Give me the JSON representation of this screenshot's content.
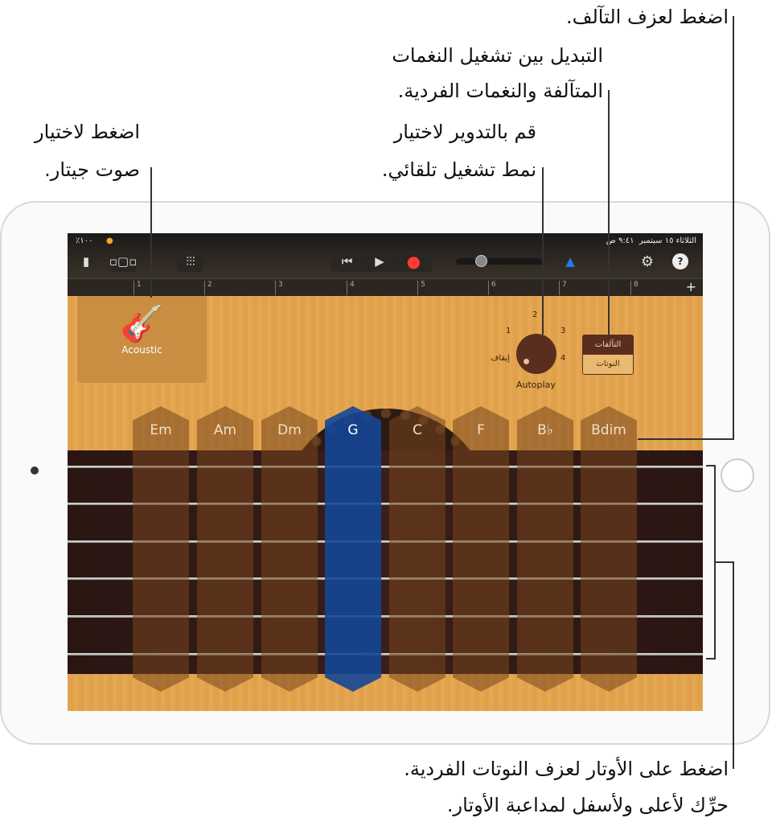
{
  "annotations": {
    "chords": "اضغط لعزف التآلف.",
    "toggle_1": "التبديل بين تشغيل النغمات",
    "toggle_2": "المتآلفة والنغمات الفردية.",
    "autoplay_1": "قم بالتدوير لاختيار",
    "autoplay_2": "نمط تشغيل تلقائي.",
    "sound_1": "اضغط لاختيار",
    "sound_2": "صوت جيتار.",
    "strings_1": "اضغط على الأوتار لعزف النوتات الفردية.",
    "strings_2": "حرِّك لأعلى ولأسفل لمداعبة الأوتار."
  },
  "status": {
    "time": "٩:٤١ ص",
    "date": "الثلاثاء ١٥ سبتمبر",
    "battery": "٪١٠٠"
  },
  "toolbar": {
    "icons": [
      "document-icon",
      "view-toggle-icon",
      "mixer-icon",
      "rewind-icon",
      "play-icon",
      "record-icon",
      "metronome-icon",
      "settings-icon",
      "help-icon"
    ],
    "record_color": "#ff3b30",
    "metronome_color": "#1e7bff",
    "help": "?"
  },
  "ruler": {
    "bars": [
      "1",
      "2",
      "3",
      "4",
      "5",
      "6",
      "7",
      "8"
    ],
    "add": "+"
  },
  "instrument": {
    "name": "Acoustic"
  },
  "autoplay": {
    "label": "Autoplay",
    "off": "إيقاف",
    "positions": [
      "1",
      "2",
      "3",
      "4"
    ]
  },
  "mode_toggle": {
    "chords": "التآلفات",
    "notes": "النوتات",
    "selected": "chords"
  },
  "chords": [
    "Em",
    "Am",
    "Dm",
    "G",
    "C",
    "F",
    "B♭",
    "Bdim"
  ],
  "selected_chord": "G"
}
